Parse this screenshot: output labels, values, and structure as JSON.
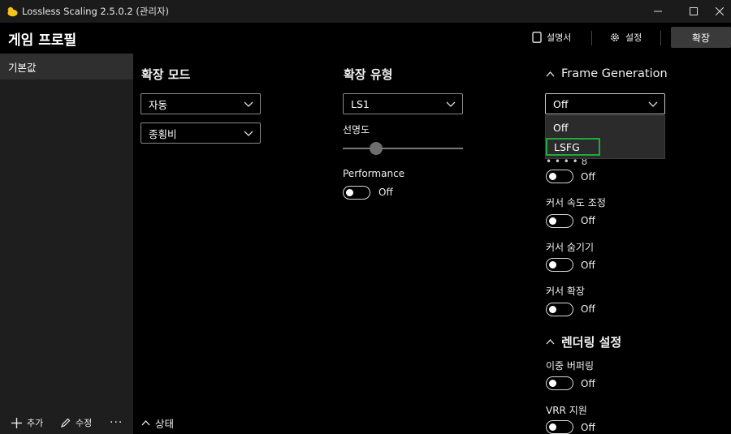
{
  "window": {
    "title": "Lossless Scaling 2.5.0.2 (관리자)",
    "minimize": "—",
    "maximize": "☐",
    "close": "✕"
  },
  "header": {
    "title": "게임 프로필",
    "guide_label": "설명서",
    "settings_label": "설정",
    "scale_label": "확장"
  },
  "sidebar": {
    "profiles": [
      "기본값"
    ],
    "add_label": "추가",
    "edit_label": "수정",
    "more_label": "···"
  },
  "status": {
    "label": "상태"
  },
  "scale_mode": {
    "title": "확장 모드",
    "mode_value": "자동",
    "aspect_value": "종횡비"
  },
  "scale_type": {
    "title": "확장 유형",
    "type_value": "LS1",
    "sharpness_label": "선명도",
    "sharpness_value": 0.28,
    "performance_label": "Performance",
    "performance_state": "Off"
  },
  "frame_generation": {
    "title": "Frame Generation",
    "value": "Off",
    "options": [
      "Off",
      "LSFG"
    ],
    "highlighted_option": "LSFG",
    "partial_label": "• • • • 8",
    "toggles": [
      {
        "label": "",
        "state": "Off"
      },
      {
        "label": "커서 속도 조정",
        "state": "Off"
      },
      {
        "label": "커서 숨기기",
        "state": "Off"
      },
      {
        "label": "커서 확장",
        "state": "Off"
      }
    ]
  },
  "rendering": {
    "title": "렌더링 설정",
    "toggles": [
      {
        "label": "이중 버퍼링",
        "state": "Off"
      },
      {
        "label": "VRR 지원",
        "state": "Off"
      }
    ]
  },
  "colors": {
    "background": "#000000",
    "sidebar": "#1e1e1e",
    "selection_outline": "#1faa3c"
  }
}
